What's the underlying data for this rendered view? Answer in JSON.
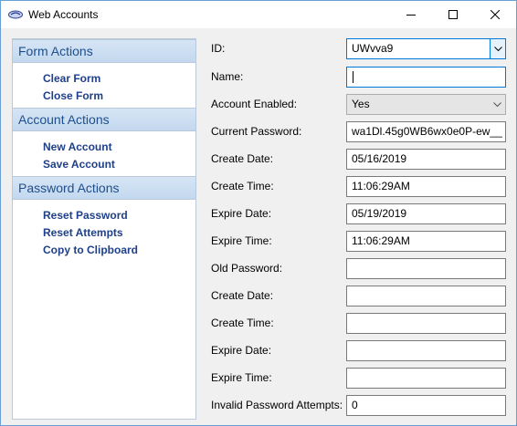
{
  "window": {
    "title": "Web Accounts"
  },
  "sidebar": {
    "groups": [
      {
        "header": "Form Actions",
        "items": [
          "Clear Form",
          "Close Form"
        ]
      },
      {
        "header": "Account Actions",
        "items": [
          "New Account",
          "Save Account"
        ]
      },
      {
        "header": "Password Actions",
        "items": [
          "Reset Password",
          "Reset Attempts",
          "Copy to Clipboard"
        ]
      }
    ]
  },
  "form": {
    "id_label": "ID:",
    "id_value": "UWvva9",
    "name_label": "Name:",
    "name_value": "",
    "enabled_label": "Account Enabled:",
    "enabled_value": "Yes",
    "current_password_label": "Current Password:",
    "current_password_value": "wa1Dl.45g0WB6wx0e0P-ew__",
    "create_date_label": "Create Date:",
    "create_date_value": "05/16/2019",
    "create_time_label": "Create Time:",
    "create_time_value": "11:06:29AM",
    "expire_date_label": "Expire Date:",
    "expire_date_value": "05/19/2019",
    "expire_time_label": "Expire Time:",
    "expire_time_value": "11:06:29AM",
    "old_password_label": "Old Password:",
    "old_password_value": "",
    "old_create_date_label": "Create Date:",
    "old_create_date_value": "",
    "old_create_time_label": "Create Time:",
    "old_create_time_value": "",
    "old_expire_date_label": "Expire Date:",
    "old_expire_date_value": "",
    "old_expire_time_label": "Expire Time:",
    "old_expire_time_value": "",
    "invalid_attempts_label": "Invalid Password Attempts:",
    "invalid_attempts_value": "0"
  },
  "colors": {
    "group_header_text": "#1e4e8c",
    "link_text": "#1e3f8a",
    "focus_border": "#0078d7"
  }
}
